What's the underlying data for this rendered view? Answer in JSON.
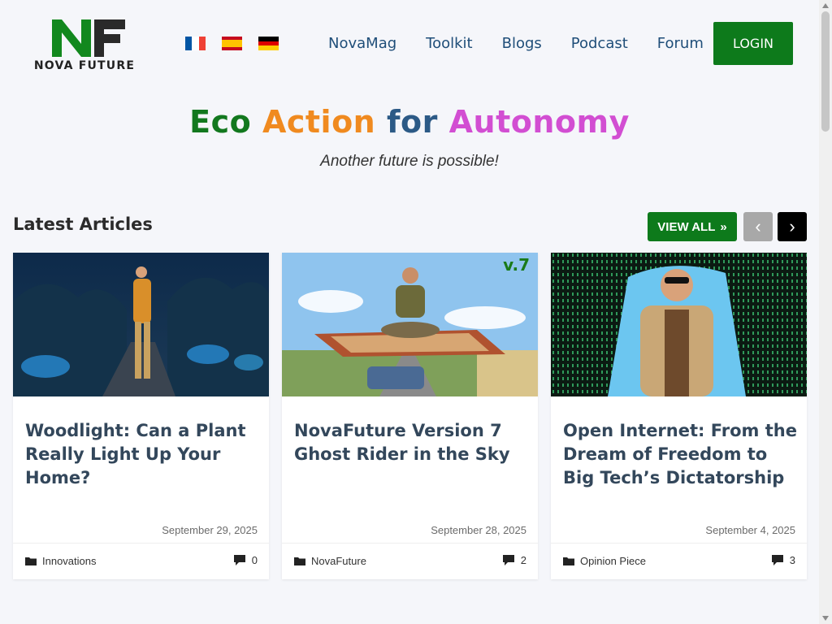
{
  "logo": {
    "text": "NOVA FUTURE",
    "mark": "NF"
  },
  "flags": [
    {
      "name": "french",
      "colors": [
        "#0055a4",
        "#ffffff",
        "#ef4135"
      ]
    },
    {
      "name": "spanish",
      "colors": [
        "#c60b1e",
        "#ffc400",
        "#c60b1e"
      ]
    },
    {
      "name": "german",
      "colors": [
        "#000000",
        "#dd0000",
        "#ffce00"
      ]
    }
  ],
  "nav": {
    "items": [
      "NovaMag",
      "Toolkit",
      "Blogs",
      "Podcast",
      "Forum"
    ],
    "login": "LOGIN"
  },
  "hero": {
    "title_words": [
      "Eco",
      "Action",
      "for",
      "Autonomy"
    ],
    "subtitle": "Another future is possible!"
  },
  "latest": {
    "title": "Latest Articles",
    "view_all": "VIEW ALL",
    "prev_icon": "‹",
    "next_icon": "›"
  },
  "articles": [
    {
      "title": "Woodlight: Can a Plant Really Light Up Your Home?",
      "date": "September 29, 2025",
      "category": "Innovations",
      "comments": "0",
      "image": "man-walking-glowing-forest-night"
    },
    {
      "title": "NovaFuture Version 7 Ghost Rider in the Sky",
      "date": "September 28, 2025",
      "category": "NovaFuture",
      "comments": "2",
      "image": "man-meditating-flying-carpet",
      "badge": "v.7"
    },
    {
      "title": "Open Internet: From the Dream of Freedom to Big Tech’s Dictatorship",
      "date": "September 4, 2025",
      "category": "Opinion Piece",
      "comments": "3",
      "image": "man-bursting-through-matrix-wall"
    }
  ],
  "colors": {
    "accent_green": "#0d7a1b",
    "nav_blue": "#1f4e79",
    "title_orange": "#f08a1f",
    "title_magenta": "#d24ed2"
  }
}
